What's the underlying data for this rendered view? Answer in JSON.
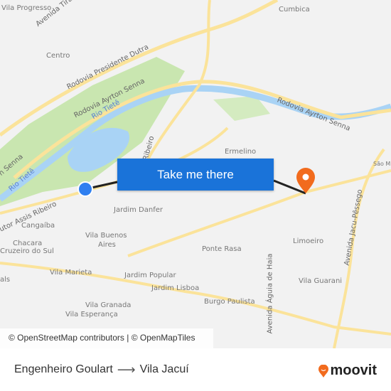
{
  "map": {
    "labels": {
      "vila_progresso": "Vila Progresso",
      "avenida_tiradentes": "Avenida Tiradentes",
      "centro": "Centro",
      "rodovia_dutra": "Rodovia Presidente Dutra",
      "rodovia_senna_1": "Rodovia Ayrton Senna",
      "rio_tiete_1": "Rio Tietê",
      "rio_tiete_2": "Rio Tietê",
      "senna_left": "n Senna",
      "cumbica": "Cumbica",
      "rodovia_senna_2": "Rodovia Ayrton Senna",
      "ermelino": "Ermelino",
      "ribeiro": "Ribeiro",
      "sao_m": "São M",
      "assis_ribeiro": "utor Assis Ribeiro",
      "jardim_danfer": "Jardim Danfer",
      "cangaiba": "Cangaíba",
      "vila_buenos_aires": "Vila Buenos",
      "aires": "Aires",
      "chacara": "Chacara",
      "cruzeiro": "Cruzeiro do Sul",
      "ponte_rasa": "Ponte Rasa",
      "limoeiro": "Limoeiro",
      "avenida_jacu": "Avenida Jacu-Pêssego",
      "vila_marieta": "Vila Marieta",
      "jardim_popular": "Jardim Popular",
      "jardim_lisboa": "Jardim Lisboa",
      "avenida_aguia": "Avenida Águia de Haia",
      "vila_guarani": "Vila Guarani",
      "burgo_paulista": "Burgo Paulista",
      "vila_granada": "Vila Granada",
      "vila_esperanca": "Vila Esperança",
      "als": "als"
    },
    "origin_color": "#2f7ff0",
    "destination_color": "#f26b1d",
    "cta": "Take me there",
    "attribution": "© OpenStreetMap contributors | © OpenMapTiles"
  },
  "footer": {
    "from": "Engenheiro Goulart",
    "to": "Vila Jacuí",
    "arrow_icon": "arrow-right-icon",
    "brand": "moovit",
    "brand_color": "#f26b1d"
  }
}
